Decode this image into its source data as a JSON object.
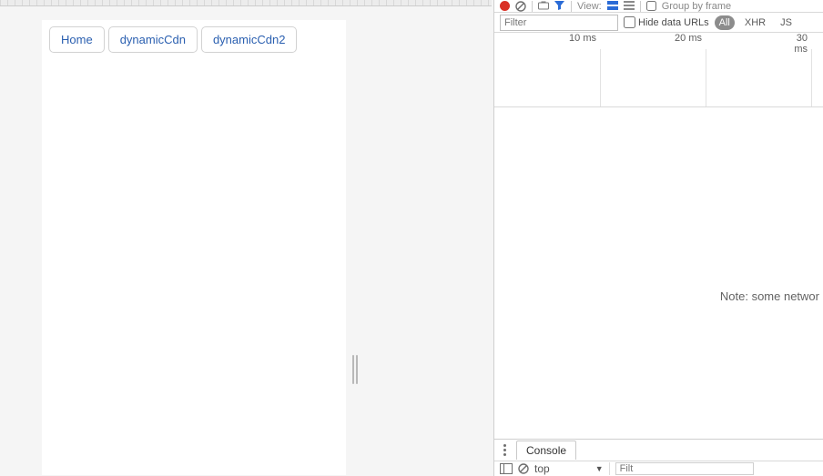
{
  "preview": {
    "tabs": [
      "Home",
      "dynamicCdn",
      "dynamicCdn2"
    ]
  },
  "devtools": {
    "toolbar": {
      "view_label": "View:",
      "group_label": "Group by frame"
    },
    "filterbar": {
      "filter_placeholder": "Filter",
      "hide_urls_label": "Hide data URLs",
      "pill_all": "All",
      "pill_xhr": "XHR",
      "pill_js": "JS"
    },
    "timeline": {
      "ticks": [
        "10 ms",
        "20 ms",
        "30 ms"
      ]
    },
    "note_text": "Note: some networ",
    "drawer": {
      "tab_label": "Console",
      "context": "top",
      "filter_placeholder": "Filt"
    }
  }
}
